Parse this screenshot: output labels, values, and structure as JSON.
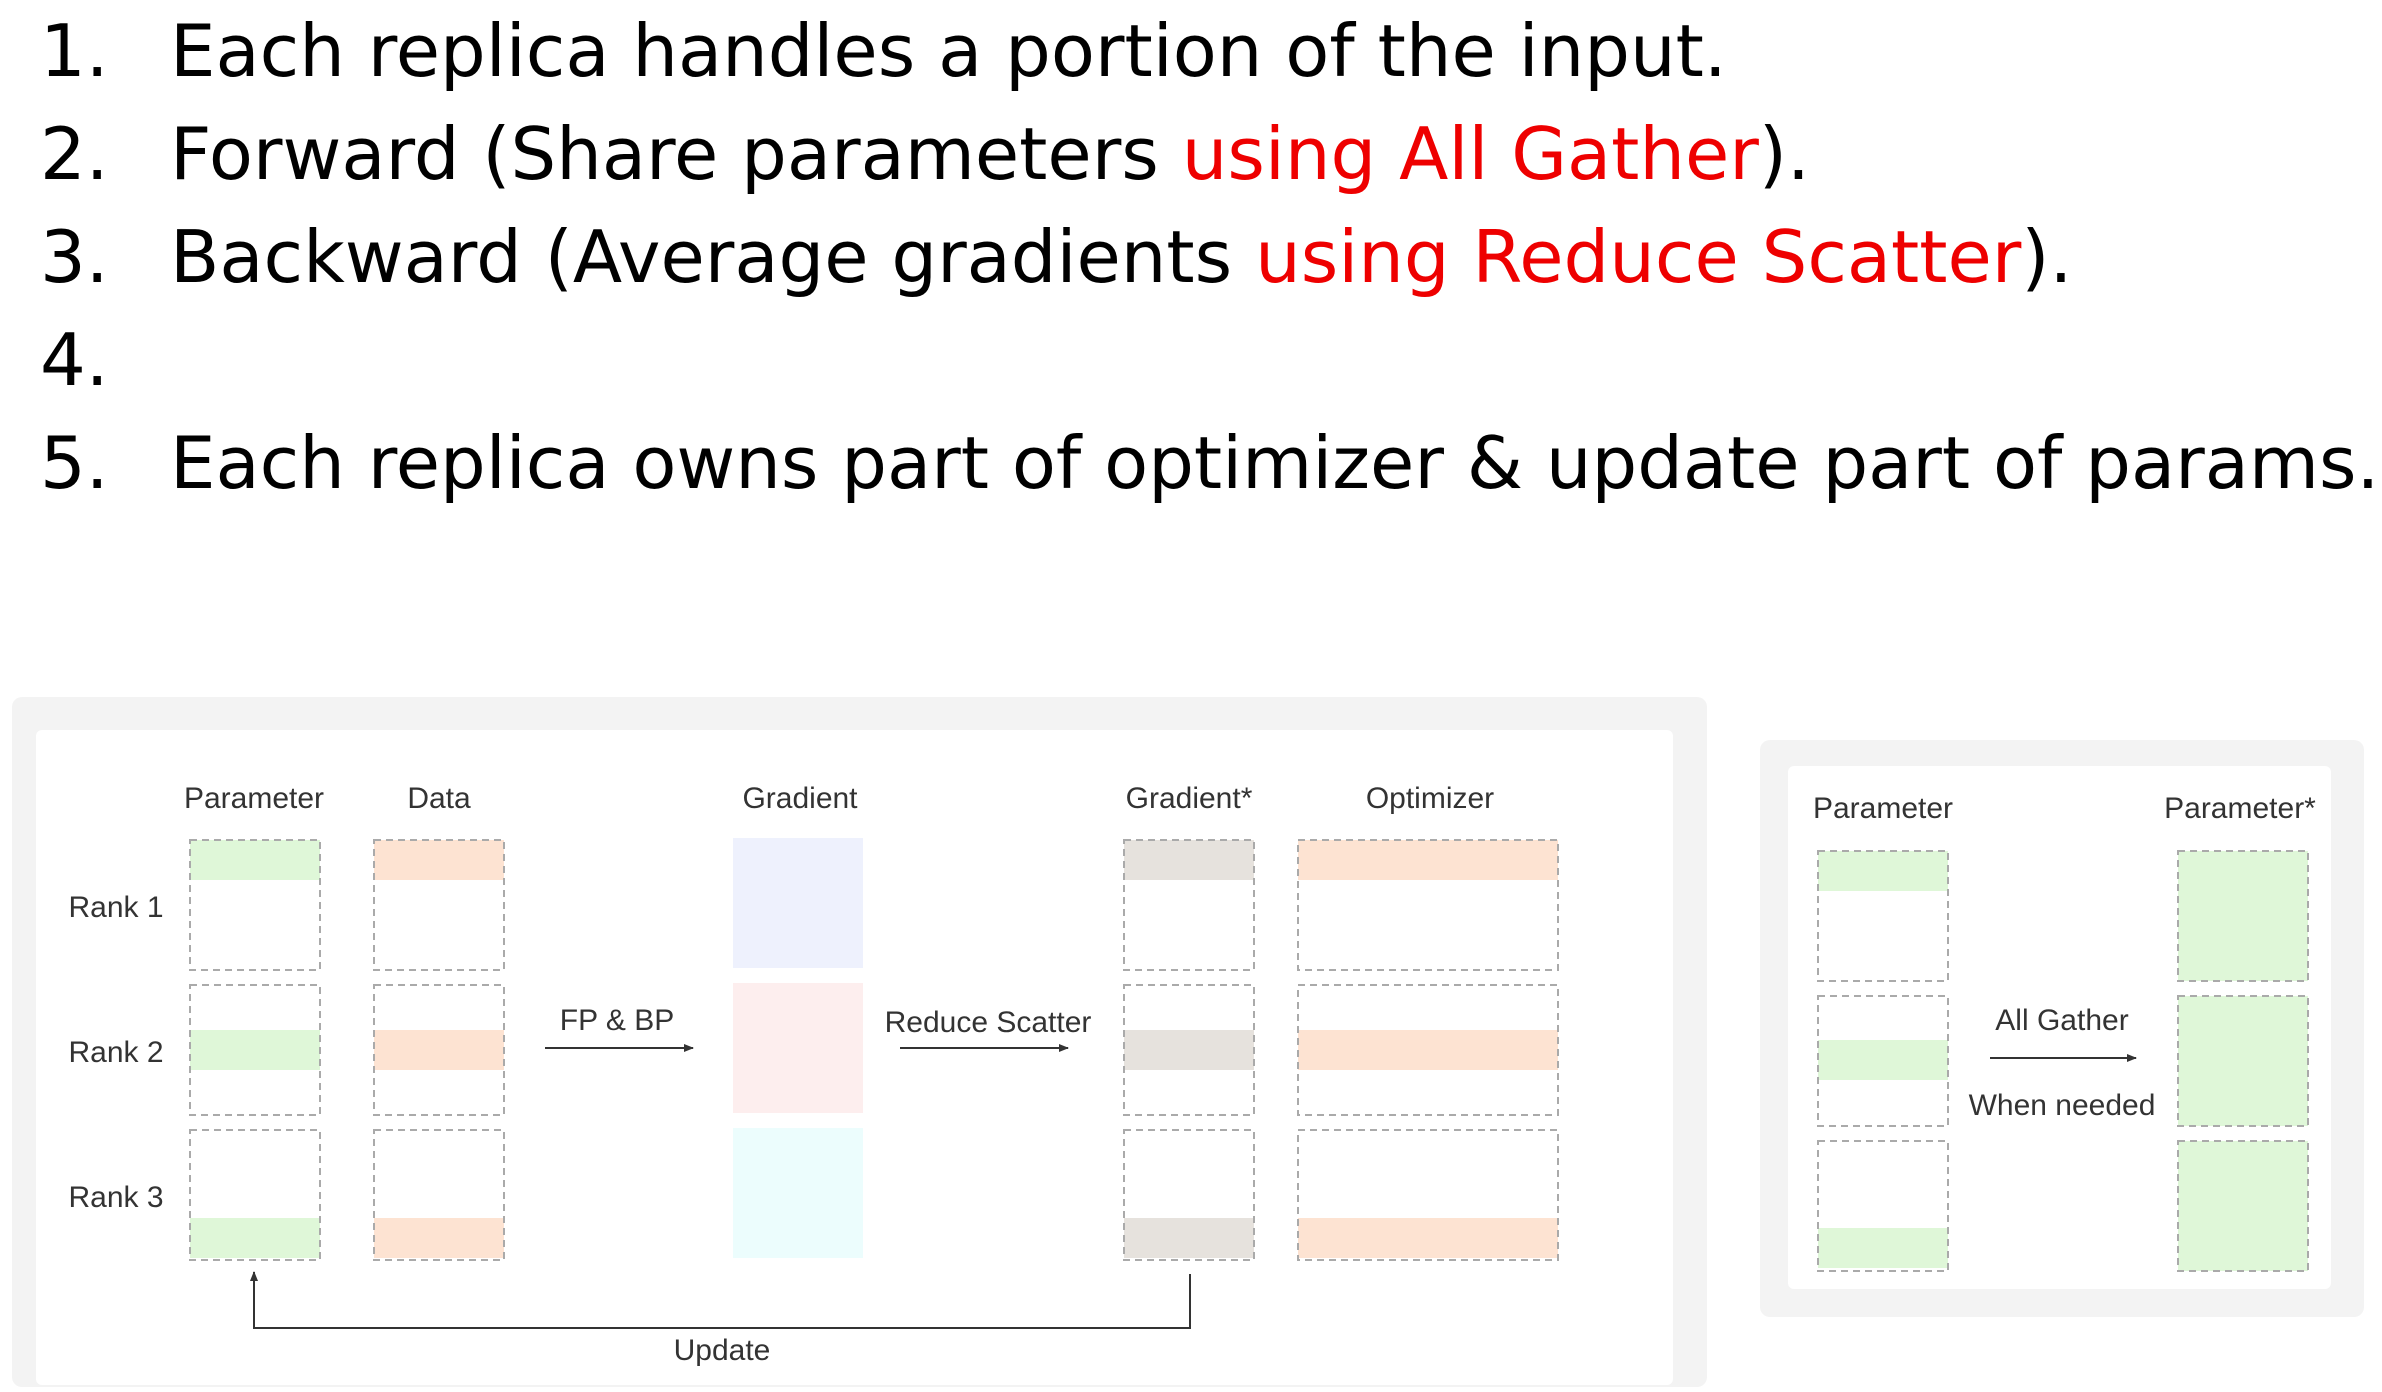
{
  "steps": [
    {
      "num": "1.",
      "text": "Each replica handles a portion of the input.",
      "red": "",
      "tail": ""
    },
    {
      "num": "2.",
      "text": "Forward (Share parameters ",
      "red": "using All Gather",
      "tail": ")."
    },
    {
      "num": "3.",
      "text": "Backward (Average gradients ",
      "red": "using Reduce Scatter",
      "tail": ")."
    },
    {
      "num": "4.",
      "text": "",
      "red": "",
      "tail": ""
    },
    {
      "num": "5.",
      "text": "Each replica owns part of optimizer & update part of params.",
      "red": "",
      "tail": ""
    }
  ],
  "left_diagram": {
    "col_parameter": "Parameter",
    "col_data": "Data",
    "col_gradient": "Gradient",
    "col_gradient_star": "Gradient*",
    "col_optimizer": "Optimizer",
    "rank1": "Rank 1",
    "rank2": "Rank 2",
    "rank3": "Rank 3",
    "fp_bp": "FP & BP",
    "reduce_scatter": "Reduce Scatter",
    "update": "Update"
  },
  "right_diagram": {
    "col_parameter": "Parameter",
    "col_parameter_star": "Parameter*",
    "all_gather": "All Gather",
    "when_needed": "When needed"
  },
  "colors": {
    "text_red": "#ee0000",
    "param_green": "#dff7d8",
    "data_orange": "#fde3d2",
    "grad_blue": "#eef1fd",
    "grad_pink": "#fdeeee",
    "grad_cyan": "#ecfdfd",
    "grad_star_gray": "#e6e2dd",
    "optimizer_orange": "#fde3d2"
  }
}
